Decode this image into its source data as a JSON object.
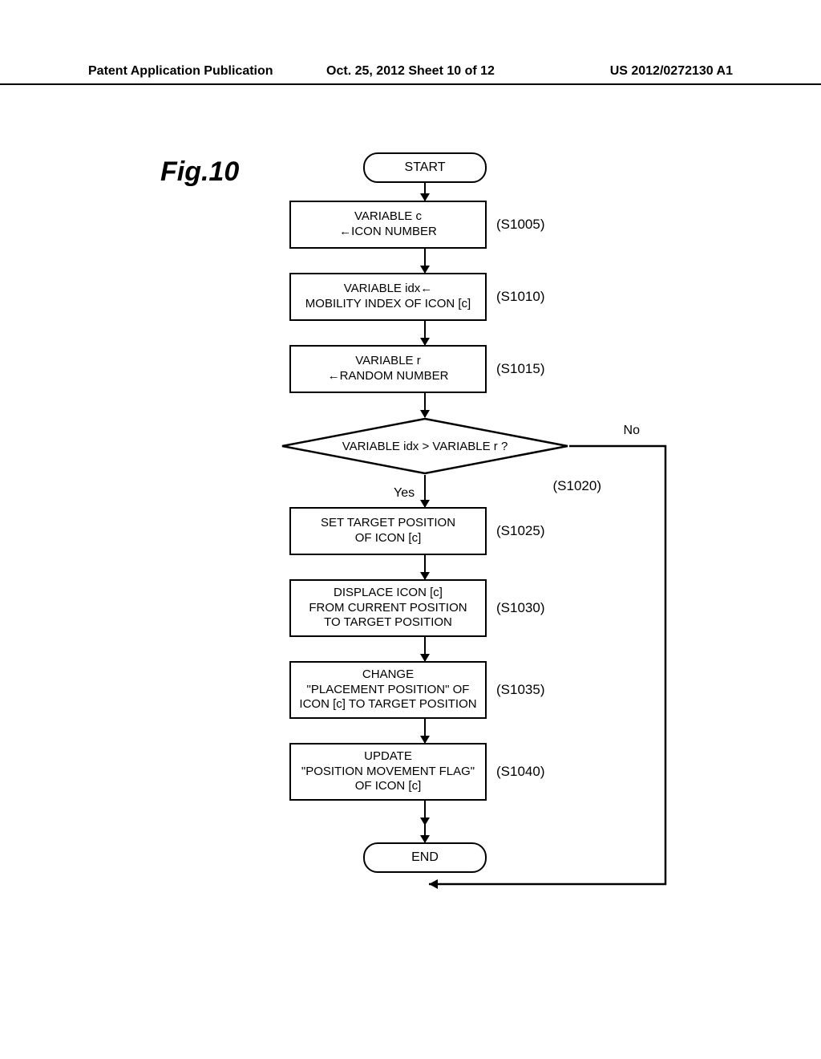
{
  "header": {
    "left": "Patent Application Publication",
    "mid": "Oct. 25, 2012  Sheet 10 of 12",
    "right": "US 2012/0272130 A1"
  },
  "figure_label": "Fig.10",
  "terminals": {
    "start": "START",
    "end": "END"
  },
  "decision": {
    "text": "VARIABLE idx > VARIABLE r ?",
    "yes": "Yes",
    "no": "No",
    "step": "(S1020)"
  },
  "steps": [
    {
      "text": "VARIABLE c\n←ICON NUMBER",
      "label": "(S1005)"
    },
    {
      "text": "VARIABLE idx←\nMOBILITY INDEX OF ICON [c]",
      "label": "(S1010)"
    },
    {
      "text": "VARIABLE r\n←RANDOM NUMBER",
      "label": "(S1015)"
    },
    {
      "text": "SET TARGET POSITION\nOF ICON [c]",
      "label": "(S1025)"
    },
    {
      "text": "DISPLACE ICON [c]\nFROM CURRENT POSITION\nTO TARGET POSITION",
      "label": "(S1030)"
    },
    {
      "text": "CHANGE\n\"PLACEMENT POSITION\" OF\nICON [c] TO TARGET POSITION",
      "label": "(S1035)"
    },
    {
      "text": "UPDATE\n\"POSITION MOVEMENT FLAG\"\nOF ICON [c]",
      "label": "(S1040)"
    }
  ]
}
